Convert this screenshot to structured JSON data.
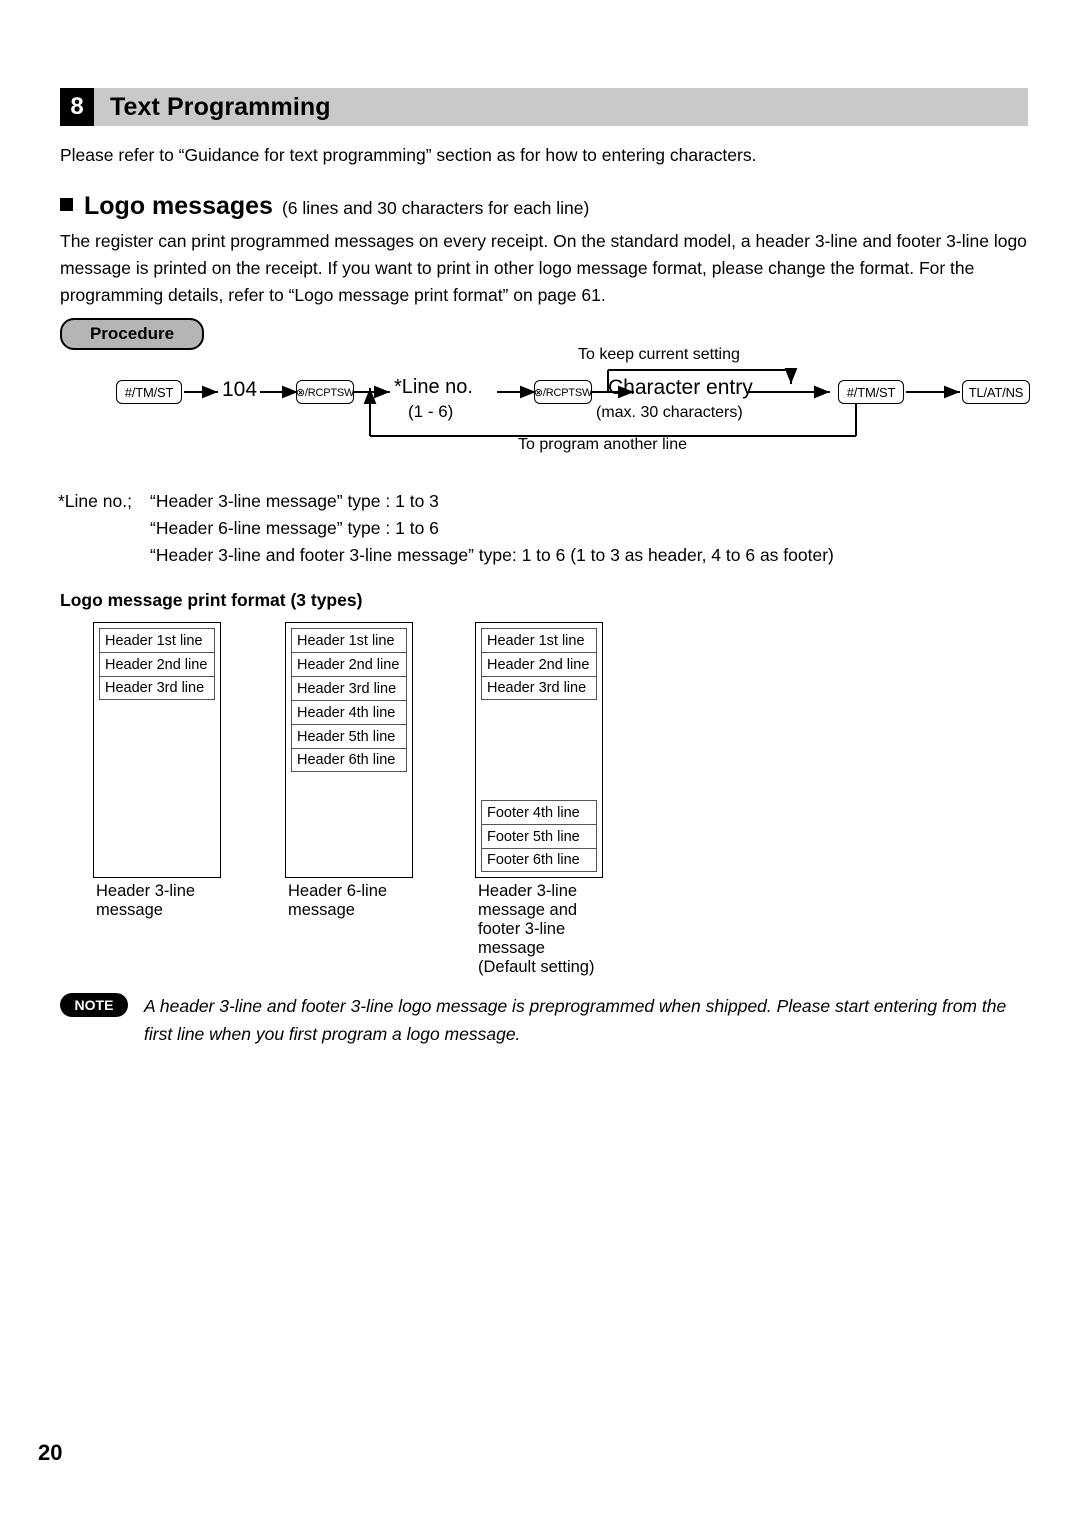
{
  "section": {
    "number": "8",
    "title": "Text Programming"
  },
  "intro": "Please refer to “Guidance for text programming” section as for how to entering characters.",
  "logo_messages": {
    "heading": "Logo messages",
    "heading_sub": "(6 lines and 30 characters for each line)",
    "paragraph": "The register can print programmed messages on every receipt. On the standard model, a header 3-line and footer 3-line logo message is printed on the receipt.  If you want to print in other logo message format, please change the format. For the programming details, refer to “Logo message print format” on page 61."
  },
  "procedure": {
    "badge_label": "Procedure",
    "keys": {
      "tm_st_1": "#/TM/ST",
      "code": "104",
      "rcptsw_1": "⊗/RCPTSW",
      "line_no": "*Line no.",
      "line_no_range": "(1 - 6)",
      "rcptsw_2": "⊗/RCPTSW",
      "char_entry": "Character entry",
      "char_entry_sub": "(max. 30 characters)",
      "tm_st_2": "#/TM/ST",
      "tl_at_ns": "TL/AT/NS"
    },
    "annotations": {
      "keep_current": "To keep current setting",
      "program_another": "To program another line"
    }
  },
  "line_no_notes": {
    "lead": "*Line no.;",
    "rows": [
      "“Header 3-line message” type :  1 to 3",
      "“Header 6-line message” type :  1 to 6",
      "“Header 3-line and footer 3-line message” type:  1 to 6 (1 to 3 as header, 4 to 6 as footer)"
    ]
  },
  "print_format": {
    "heading": "Logo message print format (3 types)",
    "types": [
      {
        "top_lines": [
          "Header 1st line",
          "Header 2nd line",
          "Header 3rd line"
        ],
        "bottom_lines": [],
        "caption": "Header 3-line\nmessage"
      },
      {
        "top_lines": [
          "Header 1st line",
          "Header 2nd line",
          "Header 3rd line",
          "Header 4th line",
          "Header 5th line",
          "Header 6th line"
        ],
        "bottom_lines": [],
        "caption": "Header 6-line\nmessage"
      },
      {
        "top_lines": [
          "Header 1st line",
          "Header 2nd line",
          "Header 3rd line"
        ],
        "bottom_lines": [
          "Footer 4th line",
          "Footer 5th line",
          "Footer 6th line"
        ],
        "caption": "Header 3-line\nmessage and\nfooter 3-line\nmessage\n(Default setting)"
      }
    ]
  },
  "note": {
    "badge": "NOTE",
    "text": "A header 3-line and footer 3-line logo message is preprogrammed when shipped.  Please start entering from the first line when you first program a logo message."
  },
  "page_number": "20",
  "colors": {
    "header_bar": "#c9c9c9",
    "badge_gray": "#b5b5b5",
    "ink": "#000000"
  }
}
